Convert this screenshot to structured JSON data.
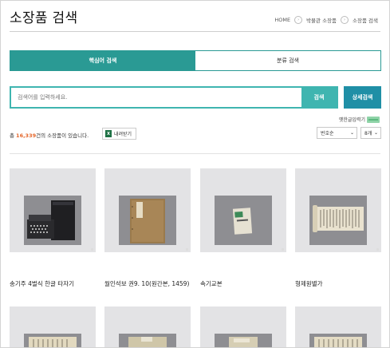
{
  "page_title": "소장품 검색",
  "breadcrumb": [
    "HOME",
    "박물관 소장품",
    "소장품 검색"
  ],
  "tabs": [
    {
      "label": "핵심어 검색",
      "active": true
    },
    {
      "label": "분류 검색",
      "active": false
    }
  ],
  "search": {
    "placeholder": "검색어를 입력하세요.",
    "value": "",
    "button": "검색"
  },
  "advanced_search_label": "상세검색",
  "old_text_input_label": "옛한글입력기",
  "results": {
    "prefix": "총 ",
    "count": "16,339",
    "suffix": "건의 소장품이 있습니다."
  },
  "download_label": "내려받기",
  "sort_select": {
    "selected": "번호순"
  },
  "per_page_select": {
    "selected": "8개"
  },
  "items": [
    {
      "title": "송기주 4벌식 한글 타자기"
    },
    {
      "title": "월인석보 권9. 10(원간본, 1459)"
    },
    {
      "title": "속기교본"
    },
    {
      "title": "형제원별가"
    }
  ],
  "colors": {
    "teal": "#2a9a94",
    "search_teal": "#3fb5b0",
    "adv_blue": "#1f8fa6",
    "count_orange": "#e4662a"
  }
}
